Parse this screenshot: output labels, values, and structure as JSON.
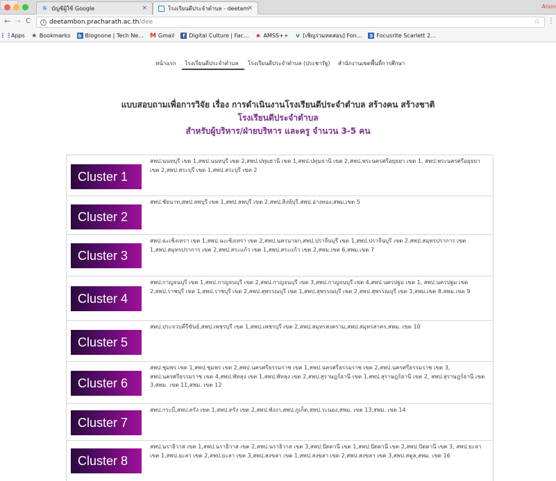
{
  "browser": {
    "tabs": [
      {
        "title": "บัญชีผู้ใช้ Google",
        "icon": "google-g-icon"
      },
      {
        "title": "โรงเรียนดีประจำตำบล - deetam",
        "icon": "page-icon"
      }
    ],
    "profile_label": "Anon",
    "url_host": "deetambon.pracharath.ac.th",
    "url_path": "/dee",
    "bookmarks": [
      {
        "label": "Apps",
        "icon": "apps-grid-icon"
      },
      {
        "label": "Bookmarks",
        "icon": "star-icon"
      },
      {
        "label": "Blognone | Tech Ne...",
        "icon": "blognone-icon"
      },
      {
        "label": "Gmail",
        "icon": "gmail-icon"
      },
      {
        "label": "Digital Culture | Fac...",
        "icon": "facebook-icon"
      },
      {
        "label": "AMSS++",
        "icon": "amss-icon"
      },
      {
        "label": "[เชิญร่วมทดสอบ] Fon...",
        "icon": "v-icon"
      },
      {
        "label": "Focusrite Scarlett 2...",
        "icon": "focusrite-icon"
      }
    ]
  },
  "site_nav": [
    "หน้าแรก",
    "โรงเรียนดีประจำตำบล",
    "โรงเรียนดีประจำตำบล (ประชารัฐ)",
    "สำนักงานเขตพื้นที่การศึกษา"
  ],
  "heading": {
    "line1": "แบบสอบถามเพื่อการวิจัย เรื่อง การดำเนินงานโรงเรียนดีประจำตำบล สร้างคน สร้างชาติ",
    "line2": "โรงเรียนดีประจำตำบล",
    "line3": "สำหรับผู้บริหาร/ฝ่ายบริหาร และครู จำนวน 3-5 คน"
  },
  "clusters": [
    {
      "label": "Cluster 1",
      "areas": "สพป.นนทบุรี เขต 1,สพป.นนทบุรี เขต 2,สพป.ปทุมธานี เขต 1,สพป.ปทุมธานี เขต 2,สพป.พระนครศรีอยุธยา เขต 1, สพป.พระนครศรีอยุธยา เขต 2,สพป.สระบุรี เขต 1,สพป.สระบุรี เขต 2"
    },
    {
      "label": "Cluster 2",
      "areas": "สพป.ชัยนาท,สพป.ลพบุรี เขต 1,สพป.ลพบุรี เขต 2,สพป.สิงห์บุรี,สพป.อ่างทอง,สพม.เขต 5"
    },
    {
      "label": "Cluster 3",
      "areas": "สพป.ฉะเชิงเทรา เขต 1,สพป.ฉะเชิงเทรา เขต 2,สพป.นครนายก,สพป.ปราจีนบุรี เขต 1,สพป.ปราจีนบุรี เขต 2,สพป.สมุทรปราการ เขต 1,สพป.สมุทรปราการ เขต 2,สพป.สระแก้ว เขต 1,สพป.สระแก้ว เขต 2,สพม.เขต 6,สพม.เขต 7"
    },
    {
      "label": "Cluster 4",
      "areas": "สพป.กาญจนบุรี เขต 1,สพป.กาญจนบุรี เขต 2,สพป.กาญจนบุรี เขต 3,สพป.กาญจนบุรี เขต 4,สพป.นครปฐม เขต 1, สพป.นครปฐม เขต 2,สพป.ราชบุรี เขต 1,สพป.ราชบุรี เขต 2,สพป.สุพรรณบุรี เขต 1,สพป.สุพรรณบุรี เขต 2,สพป.สุพรรณบุรี เขต 3,สพม.เขต 8,สพม.เขต 9"
    },
    {
      "label": "Cluster 5",
      "areas": "สพป.ประจวบคีรีขันธ์,สพป.เพชรบุรี เขต 1,สพป.เพชรบุรี เขต 2,สพป.สมุทรสงคราม,สพป.สมุทรสาคร,สพม. เขต 10"
    },
    {
      "label": "Cluster 6",
      "areas": "สพป.ชุมพร เขต 1,สพป.ชุมพร เขต 2,สพป.นครศรีธรรมราช เขต 1,สพป.นครศรีธรรมราช เขต 2,สพป.นครศรีธรรมราช เขต 3, สพป.นครศรีธรรมราช เขต 4,สพป.พัทลุง เขต 1,สพป.พัทลุง เขต 2,สพป.สุราษฎร์ธานี เขต 1,สพป.สุราษฎร์ธานี เขต 2, สพป.สุราษฎร์ธานี เขต 3,สพม. เขต 11,สพม. เขต 12"
    },
    {
      "label": "Cluster 7",
      "areas": "สพป.กระบี่,สพป.ตรัง เขต 1,สพป.ตรัง เขต 2,สพป.พังงา,สพป.ภูเก็ต,สพป.ระนอง,สพม. เขต 13,สพม. เขต 14"
    },
    {
      "label": "Cluster 8",
      "areas": "สพป.นราธิวาส เขต 1,สพป.นราธิวาส เขต 2,สพป.นราธิวาส เขต 3,สพป.ปัตตานี เขต 1,สพป.ปัตตานี เขต 2,สพป.ปัตตานี เขต 3, สพป.ยะลา เขต 1,สพป.ยะลา เขต 2,สพป.ยะลา เขต 3,สพป.สงขลา เขต 1,สพป.สงขลา เขต 2,สพป.สงขลา เขต 3,สพป.สตูล,สพม. เขต 16"
    }
  ]
}
